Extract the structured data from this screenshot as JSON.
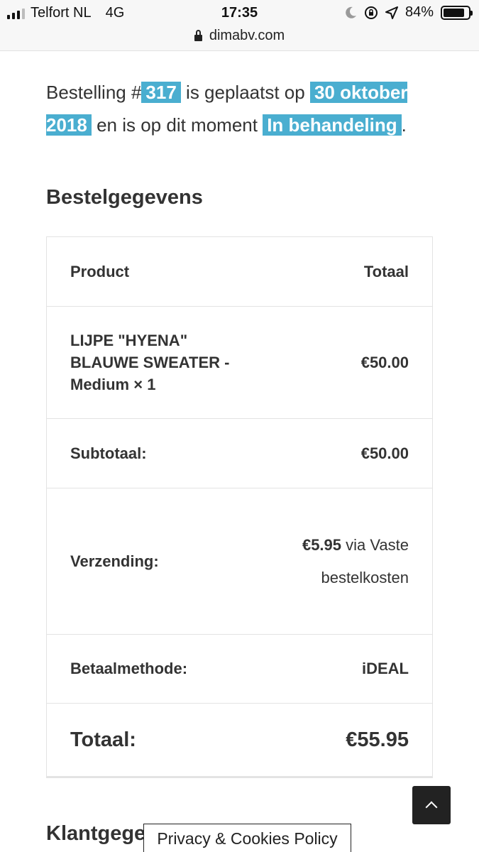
{
  "status_bar": {
    "carrier": "Telfort NL",
    "network": "4G",
    "time": "17:35",
    "battery": "84%",
    "battery_level": 0.84
  },
  "browser": {
    "url": "dimabv.com"
  },
  "intro": {
    "prefix": "Bestelling #",
    "order_number": "317",
    "placed_text": " is geplaatst op ",
    "date": "30 oktober 2018",
    "status_text": " en is op dit moment ",
    "status": "In behandeling",
    "suffix": "."
  },
  "order_details": {
    "title": "Bestelgegevens",
    "header": {
      "product": "Product",
      "total": "Totaal"
    },
    "item": {
      "name": "LIJPE \"HYENA\" BLAUWE SWEATER - Medium",
      "qty": " × 1",
      "price": "€50.00"
    },
    "subtotal": {
      "label": "Subtotaal:",
      "value": "€50.00"
    },
    "shipping": {
      "label": "Verzending:",
      "amount": "€5.95",
      "method": " via Vaste bestelkosten"
    },
    "payment": {
      "label": "Betaalmethode:",
      "value": "iDEAL"
    },
    "total": {
      "label": "Totaal:",
      "value": "€55.95"
    }
  },
  "customer_section": {
    "title": "Klantgegevens"
  },
  "cookie_bar": {
    "label": "Privacy & Cookies Policy"
  },
  "icons": {
    "back_to_top": "chevron-up-icon",
    "lock": "lock-icon",
    "moon": "moon-icon",
    "location": "location-arrow-icon"
  }
}
